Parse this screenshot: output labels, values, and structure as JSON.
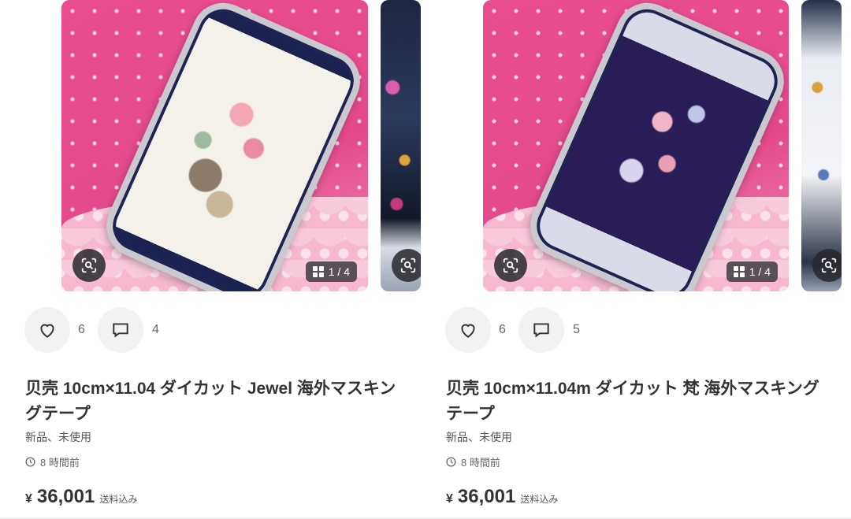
{
  "items": [
    {
      "likes": "6",
      "comments": "4",
      "image_counter": "1 / 4",
      "title": "贝壳 10cm×11.04 ダイカット Jewel 海外マスキングテープ",
      "condition": "新品、未使用",
      "time": "8 時間前",
      "currency": "¥",
      "price": "36,001",
      "shipping": "送料込み"
    },
    {
      "likes": "6",
      "comments": "5",
      "image_counter": "1 / 4",
      "title": "贝壳 10cm×11.04m ダイカット 梵 海外マスキングテープ",
      "condition": "新品、未使用",
      "time": "8 時間前",
      "currency": "¥",
      "price": "36,001",
      "shipping": "送料込み"
    }
  ],
  "colors": {
    "pink": "#e44a8b",
    "text": "#333333",
    "action_bg": "#f2f2f3"
  },
  "icons": [
    "image-search-icon",
    "gallery-grid-icon",
    "heart-icon",
    "comment-icon",
    "clock-icon"
  ]
}
